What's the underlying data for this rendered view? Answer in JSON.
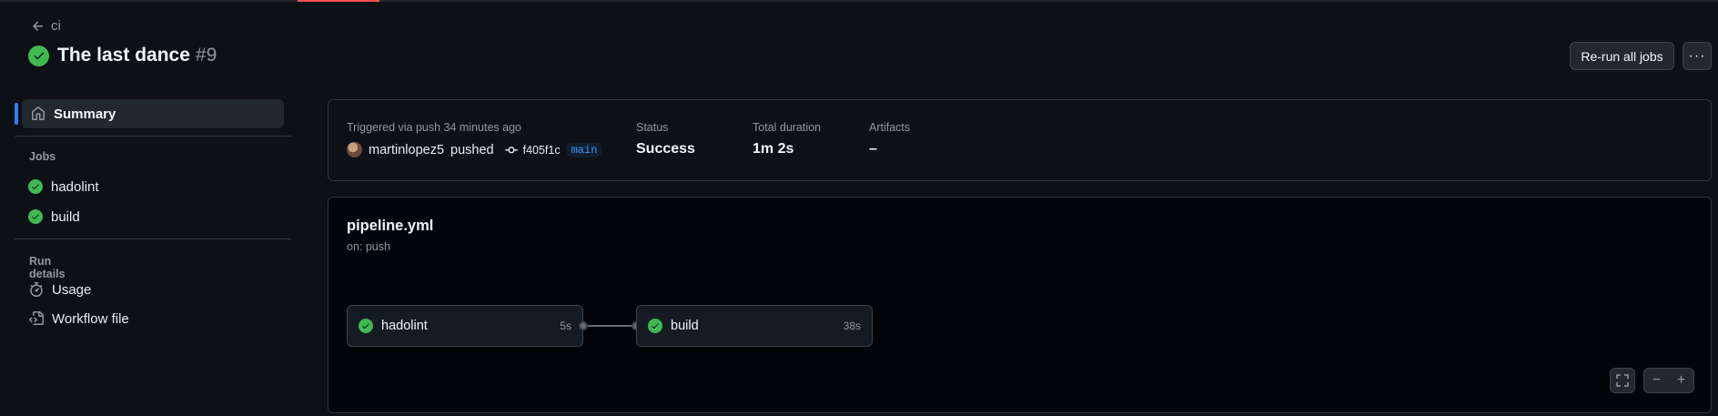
{
  "colors": {
    "accent_progress": "#f85149",
    "success": "#3fb950",
    "active_bar": "#2f81f7"
  },
  "header": {
    "back_label": "ci",
    "title": "The last dance",
    "run_number": "#9",
    "rerun_label": "Re-run all jobs",
    "more_label": "···"
  },
  "sidebar": {
    "summary_label": "Summary",
    "jobs_heading": "Jobs",
    "jobs": [
      {
        "label": "hadolint",
        "icon": "check-circle-icon"
      },
      {
        "label": "build",
        "icon": "check-circle-icon"
      }
    ],
    "run_details_heading": "Run details",
    "details": [
      {
        "label": "Usage",
        "icon": "stopwatch-icon"
      },
      {
        "label": "Workflow file",
        "icon": "file-code-icon"
      }
    ]
  },
  "summary": {
    "trigger_label": "Triggered via push 34 minutes ago",
    "actor": "martinlopez5",
    "action": "pushed",
    "commit": "f405f1c",
    "branch": "main",
    "status_label": "Status",
    "status_value": "Success",
    "duration_label": "Total duration",
    "duration_value": "1m 2s",
    "artifacts_label": "Artifacts",
    "artifacts_value": "–"
  },
  "pipeline": {
    "filename": "pipeline.yml",
    "trigger": "on: push",
    "jobs": [
      {
        "name": "hadolint",
        "duration": "5s"
      },
      {
        "name": "build",
        "duration": "38s"
      }
    ],
    "zoom_out_label": "−",
    "zoom_in_label": "+"
  }
}
